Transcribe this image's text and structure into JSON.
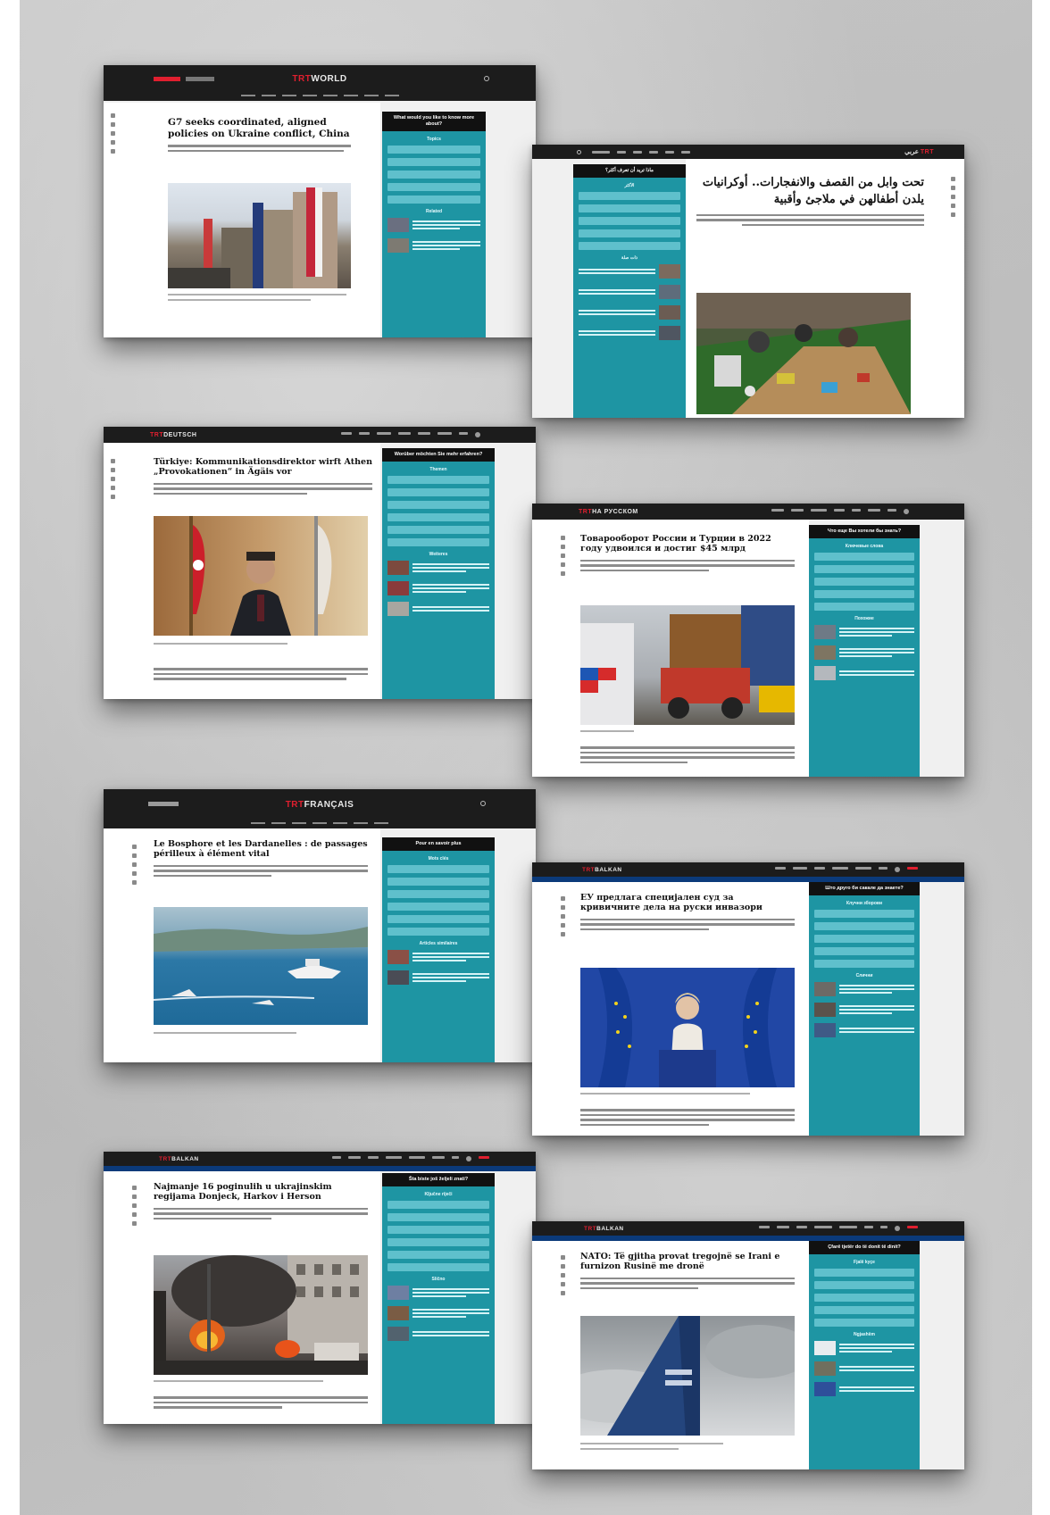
{
  "screens": {
    "s1": {
      "logo_trt": "TRT",
      "logo_site": "WORLD",
      "title": "G7 seeks coordinated, aligned policies on Ukraine conflict, China",
      "side_head": "What would you like to know more about?",
      "side_topics": "Topics",
      "side_related": "Related"
    },
    "s2": {
      "logo_trt": "TRT",
      "logo_site": "عربي",
      "title": "تحت وابل من القصف والانفجارات.. أوكرانيات يلدن أطفالهن في ملاجئ وأقبية",
      "side_head": "ماذا تريد أن تعرف أكثر؟",
      "side_topics": "الأكثر",
      "side_related": "ذات صلة"
    },
    "s3": {
      "logo_trt": "TRT",
      "logo_site": "DEUTSCH",
      "title": "Türkiye: Kommunikationsdirektor wirft Athen „Provokationen“ in Ägäis vor",
      "side_head": "Worüber möchten Sie mehr erfahren?",
      "side_topics": "Themen",
      "side_related": "Weiteres"
    },
    "s4": {
      "logo_trt": "TRT",
      "logo_site": "НА РУССКОМ",
      "title": "Товарооборот России и Турции в 2022 году удвоился и достиг $45 млрд",
      "side_head": "Что еще Вы хотели бы знать?",
      "side_topics": "Ключевые слова",
      "side_related": "Похожие"
    },
    "s5": {
      "logo_trt": "TRT",
      "logo_site": "FRANÇAIS",
      "title": "Le Bosphore et les Dardanelles : de passages périlleux à élément vital",
      "side_head": "Pour en savoir plus",
      "side_topics": "Mots clés",
      "side_related": "Articles similaires"
    },
    "s6": {
      "logo_trt": "TRT",
      "logo_site": "BALKAN",
      "title": "ЕУ предлага специјален суд за кривичните дела на руски инвазори",
      "side_head": "Што друго би сакале да знаете?",
      "side_topics": "Клучни зборови",
      "side_related": "Слични"
    },
    "s7": {
      "logo_trt": "TRT",
      "logo_site": "BALKAN",
      "title": "Najmanje 16 poginulih u ukrajinskim regijama Donjeck, Harkov i Herson",
      "side_head": "Šta biste još željeli znati?",
      "side_topics": "Ključne riječi",
      "side_related": "Slično"
    },
    "s8": {
      "logo_trt": "TRT",
      "logo_site": "BALKAN",
      "title": "NATO: Të gjitha provat tregojnë se Irani e furnizon Rusinë me dronë",
      "side_head": "Çfarë tjetër do të donit të dinit?",
      "side_topics": "Fjalë kyçe",
      "side_related": "Ngjashëm"
    }
  },
  "colors": {
    "topbar": "#1c1c1c",
    "sidebar": "#1e95a3",
    "sidebar_button": "#5fc0cc",
    "brand_red": "#e01f2f",
    "balkan_blue": "#0b3a7a"
  }
}
